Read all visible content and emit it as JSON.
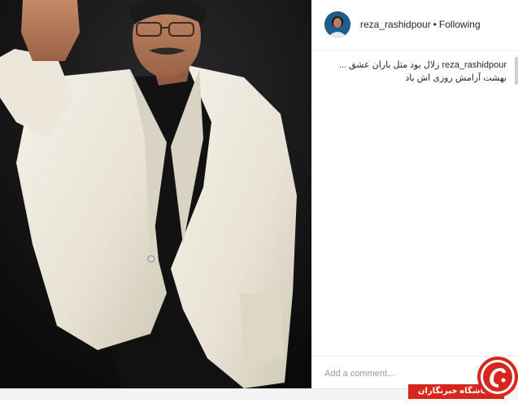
{
  "post": {
    "username": "reza_rashidpour",
    "separator": "•",
    "follow_status": "Following"
  },
  "caption": {
    "username": "reza_rashidpour",
    "text": "زلال بود مثل باران عشق ... بهشت آرامش روزی اش باد"
  },
  "comment": {
    "placeholder": "Add a comment..."
  },
  "watermark": {
    "text": "باشگاه خبرنگاران",
    "color": "#d7261c"
  },
  "colors": {
    "text": "#262626",
    "placeholder": "#999999",
    "divider": "#efefef"
  }
}
